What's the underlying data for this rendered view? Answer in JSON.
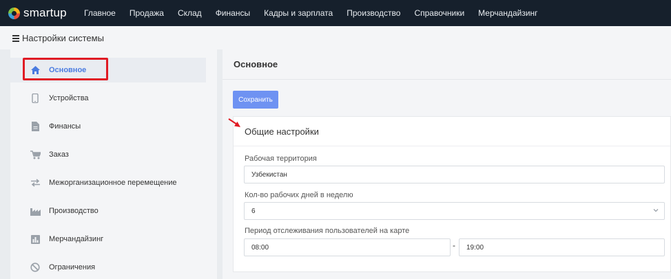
{
  "brand": {
    "name": "smartup"
  },
  "nav": {
    "items": [
      "Главное",
      "Продажа",
      "Склад",
      "Финансы",
      "Кадры и зарплата",
      "Производство",
      "Справочники",
      "Мерчандайзинг"
    ]
  },
  "page": {
    "title": "Настройки системы"
  },
  "sidebar": {
    "items": [
      {
        "label": "Основное",
        "icon": "home-icon",
        "active": true
      },
      {
        "label": "Устройства",
        "icon": "phone-icon"
      },
      {
        "label": "Финансы",
        "icon": "document-icon"
      },
      {
        "label": "Заказ",
        "icon": "cart-icon"
      },
      {
        "label": "Межорганизационное перемещение",
        "icon": "exchange-icon"
      },
      {
        "label": "Производство",
        "icon": "factory-icon"
      },
      {
        "label": "Мерчандайзинг",
        "icon": "bar-chart-icon"
      },
      {
        "label": "Ограничения",
        "icon": "ban-icon"
      }
    ]
  },
  "main": {
    "title": "Основное",
    "save_label": "Сохранить",
    "card": {
      "title": "Общие настройки",
      "territory_label": "Рабочая территория",
      "territory_value": "Узбекистан",
      "workdays_label": "Кол-во рабочих дней в неделю",
      "workdays_value": "6",
      "tracking_label": "Период отслеживания пользователей на карте",
      "tracking_from": "08:00",
      "tracking_separator": "-",
      "tracking_to": "19:00"
    }
  },
  "colors": {
    "accent": "#6e92f2",
    "active_text": "#4a7be0",
    "highlight": "#e01b24",
    "nav_bg": "#16202c"
  }
}
